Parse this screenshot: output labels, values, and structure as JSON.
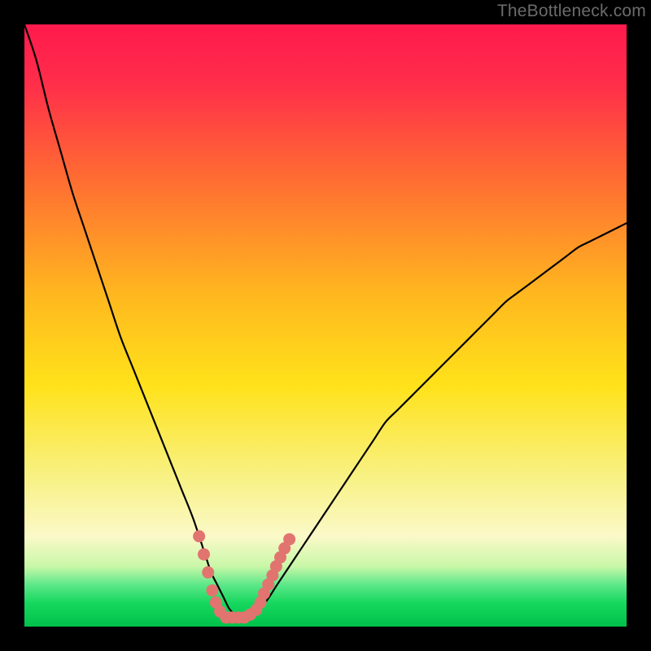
{
  "watermark": "TheBottleneck.com",
  "colors": {
    "black": "#000000",
    "curve": "#000000",
    "marker": "#e2746f",
    "grad_top": "#ff1a4d",
    "grad_mid_high": "#ff7a2a",
    "grad_mid": "#ffd400",
    "grad_mid_low": "#f6f26a",
    "grad_pale": "#fbf9c8",
    "grad_green_band": "#29f07a",
    "grad_bottom": "#00c24a"
  },
  "chart_data": {
    "type": "line",
    "title": "",
    "xlabel": "",
    "ylabel": "",
    "xlim": [
      0,
      100
    ],
    "ylim": [
      0,
      100
    ],
    "grid": false,
    "legend": false,
    "x": [
      0,
      2,
      4,
      6,
      8,
      10,
      12,
      14,
      16,
      18,
      20,
      22,
      24,
      26,
      28,
      30,
      31,
      32,
      33,
      34,
      35,
      36,
      37,
      38,
      40,
      42,
      44,
      46,
      48,
      50,
      52,
      54,
      56,
      58,
      60,
      62,
      64,
      66,
      68,
      70,
      72,
      74,
      76,
      78,
      80,
      82,
      84,
      86,
      88,
      90,
      92,
      94,
      96,
      98,
      100
    ],
    "series": [
      {
        "name": "bottleneck-curve",
        "values": [
          100,
          94,
          86,
          79,
          72,
          66,
          60,
          54,
          48,
          43,
          38,
          33,
          28,
          23,
          18,
          12,
          9,
          7,
          5,
          3,
          2,
          1.5,
          1.5,
          2,
          4,
          7,
          10,
          13,
          16,
          19,
          22,
          25,
          28,
          31,
          34,
          36,
          38,
          40,
          42,
          44,
          46,
          48,
          50,
          52,
          54,
          55.5,
          57,
          58.5,
          60,
          61.5,
          63,
          64,
          65,
          66,
          67
        ]
      }
    ],
    "markers": {
      "name": "highlight-region",
      "points": [
        {
          "x": 29.0,
          "y": 15.0
        },
        {
          "x": 29.8,
          "y": 12.0
        },
        {
          "x": 30.5,
          "y": 9.0
        },
        {
          "x": 31.2,
          "y": 6.0
        },
        {
          "x": 31.8,
          "y": 4.0
        },
        {
          "x": 32.5,
          "y": 2.5
        },
        {
          "x": 33.5,
          "y": 1.5
        },
        {
          "x": 34.5,
          "y": 1.5
        },
        {
          "x": 35.5,
          "y": 1.5
        },
        {
          "x": 36.5,
          "y": 1.5
        },
        {
          "x": 37.5,
          "y": 2.0
        },
        {
          "x": 38.5,
          "y": 2.8
        },
        {
          "x": 39.2,
          "y": 4.0
        },
        {
          "x": 39.8,
          "y": 5.5
        },
        {
          "x": 40.5,
          "y": 7.0
        },
        {
          "x": 41.2,
          "y": 8.5
        },
        {
          "x": 41.8,
          "y": 10.0
        },
        {
          "x": 42.5,
          "y": 11.5
        },
        {
          "x": 43.2,
          "y": 13.0
        },
        {
          "x": 44.0,
          "y": 14.5
        }
      ]
    },
    "background_gradient_stops": [
      {
        "offset": 0.0,
        "color": "#ff1a4d"
      },
      {
        "offset": 0.1,
        "color": "#ff2e4a"
      },
      {
        "offset": 0.25,
        "color": "#ff6a33"
      },
      {
        "offset": 0.45,
        "color": "#ffb81f"
      },
      {
        "offset": 0.6,
        "color": "#ffe21a"
      },
      {
        "offset": 0.75,
        "color": "#f8f183"
      },
      {
        "offset": 0.85,
        "color": "#fbf9c8"
      },
      {
        "offset": 0.9,
        "color": "#c9f7a8"
      },
      {
        "offset": 0.93,
        "color": "#5fe88a"
      },
      {
        "offset": 0.96,
        "color": "#17d85f"
      },
      {
        "offset": 1.0,
        "color": "#00c24a"
      }
    ]
  }
}
